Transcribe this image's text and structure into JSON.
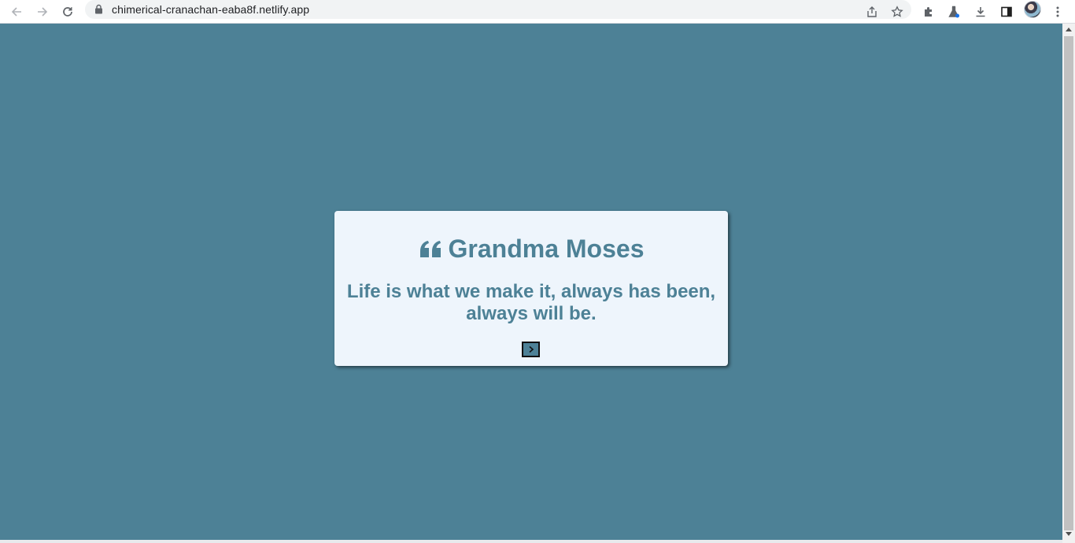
{
  "browser": {
    "url": "chimerical-cranachan-eaba8f.netlify.app",
    "icons": [
      "back-arrow-icon",
      "forward-arrow-icon",
      "reload-icon",
      "lock-icon",
      "share-icon",
      "star-icon",
      "extensions-icon",
      "labs-flask-icon",
      "download-icon",
      "side-panel-icon",
      "avatar",
      "kebab-menu-icon"
    ]
  },
  "page": {
    "background_color": "#4d8196",
    "card_color": "#eef5fc",
    "quote": {
      "author": "Grandma Moses",
      "text": "Life is what we make it, always has been, always will be."
    },
    "next_button_icon": "chevron-right-icon"
  }
}
